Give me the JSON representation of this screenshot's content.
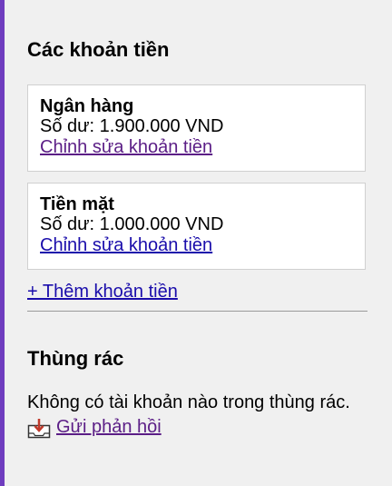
{
  "accounts_section": {
    "title": "Các khoản tiền",
    "items": [
      {
        "name": "Ngân hàng",
        "balance": "Số dư: 1.900.000 VND",
        "edit_label": "Chỉnh sửa khoản tiền"
      },
      {
        "name": "Tiền mặt",
        "balance": "Số dư: 1.000.000 VND",
        "edit_label": "Chỉnh sửa khoản tiền"
      }
    ],
    "add_label": "+ Thêm khoản tiền"
  },
  "trash_section": {
    "title": "Thùng rác",
    "empty_message": "Không có tài khoản nào trong thùng rác."
  },
  "feedback": {
    "label": "Gửi phản hồi",
    "icon": "feedback-inbox-icon"
  },
  "colors": {
    "accent": "#6f3dbf",
    "link": "#1a0dab",
    "visited_link": "#5b1e86",
    "background": "#f0f0f0"
  }
}
